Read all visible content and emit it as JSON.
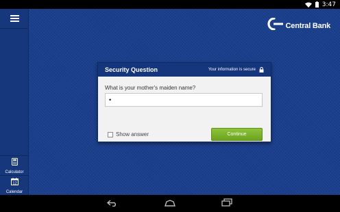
{
  "status_bar": {
    "time": "3:47",
    "icons": [
      "wifi-icon",
      "battery-icon"
    ]
  },
  "sidebar": {
    "menu_icon": "hamburger-icon",
    "tools": [
      {
        "label": "Calculator",
        "icon": "calculator-icon"
      },
      {
        "label": "Calendar",
        "icon": "calendar-icon",
        "icon_text": "12"
      }
    ]
  },
  "brand": {
    "name": "Central Bank",
    "logo_icon": "central-bank-logo"
  },
  "dialog": {
    "title": "Security Question",
    "secure_note": "Your information is secure",
    "secure_icon": "lock-icon",
    "question": "What is your mother's maiden name?",
    "answer_value": "•",
    "answer_placeholder": "",
    "show_answer_label": "Show answer",
    "show_answer_checked": false,
    "continue_label": "Continue"
  },
  "nav_bar": {
    "buttons": [
      "back-icon",
      "home-icon",
      "recents-icon"
    ]
  },
  "colors": {
    "app_background": "#1a3e8c",
    "dialog_header": "#15357c",
    "continue_button": "#7cb32b"
  }
}
